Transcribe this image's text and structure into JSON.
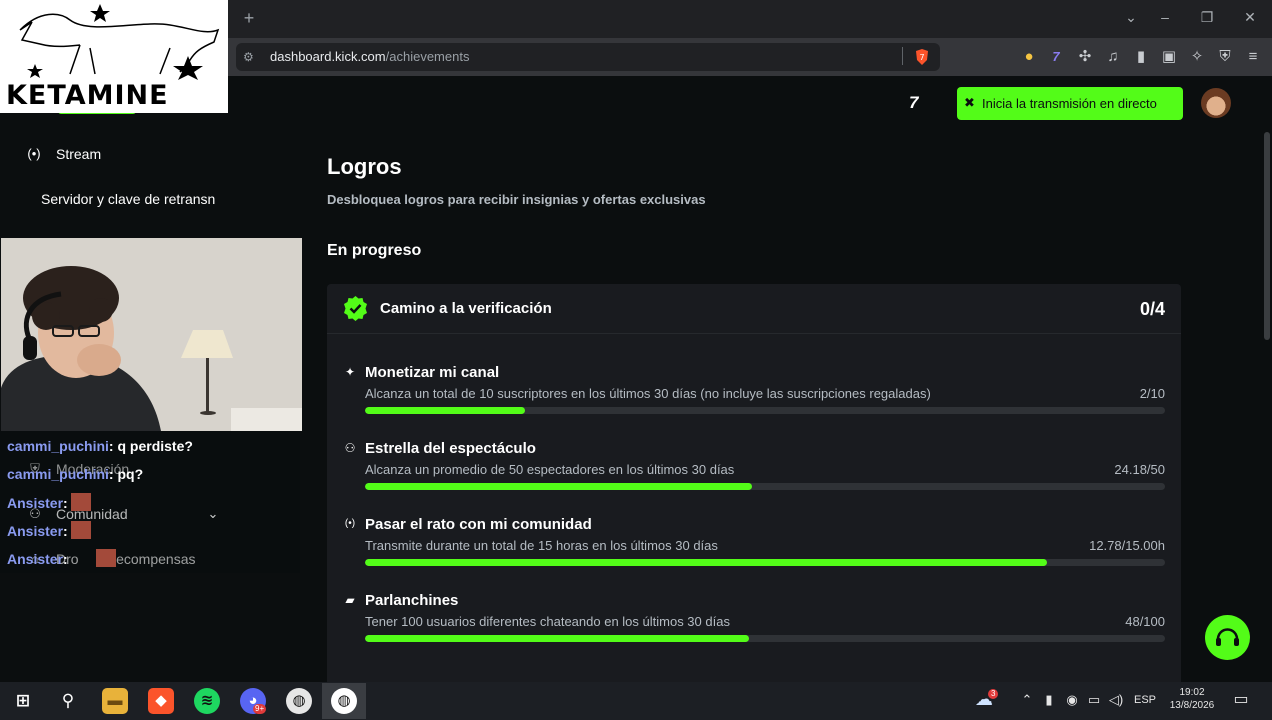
{
  "browser": {
    "url_host": "dashboard.kick.com",
    "url_path": "/achievements",
    "new_tab_label": "+",
    "shield_badge": "7",
    "window_controls": [
      "⌄",
      "–",
      "❐",
      "✕"
    ]
  },
  "header": {
    "go_live_label": "Inicia la transmisión en directo"
  },
  "sidebar": {
    "items": [
      {
        "label": "Stream",
        "icon": "broadcast-icon"
      },
      {
        "label": "Servidor y clave de retransn"
      },
      {
        "label": "Moderación",
        "icon": "shield-icon"
      },
      {
        "label": "Comunidad",
        "icon": "people-icon"
      },
      {
        "label": "Dro",
        "suffix": "y recompensas",
        "icon": "gift-icon"
      }
    ]
  },
  "main": {
    "title": "Logros",
    "subtitle": "Desbloquea logros para recibir insignias y ofertas exclusivas",
    "section_title": "En progreso",
    "card": {
      "title": "Camino a la verificación",
      "count": "0/4",
      "achievements": [
        {
          "title": "Monetizar mi canal",
          "desc": "Alcanza un total de 10 suscriptores en los últimos 30 días (no incluye las suscripciones regaladas)",
          "value_text": "2/10",
          "progress": 0.2,
          "icon": "sparkle-icon"
        },
        {
          "title": "Estrella del espectáculo",
          "desc": "Alcanza un promedio de 50 espectadores en los últimos 30 días",
          "value_text": "24.18/50",
          "progress": 0.4836,
          "icon": "viewers-icon"
        },
        {
          "title": "Pasar el rato con mi comunidad",
          "desc": "Transmite durante un total de 15 horas en los últimos 30 días",
          "value_text": "12.78/15.00h",
          "progress": 0.852,
          "icon": "broadcast-icon"
        },
        {
          "title": "Parlanchines",
          "desc": "Tener 100 usuarios diferentes chateando en los últimos 30 días",
          "value_text": "48/100",
          "progress": 0.48,
          "icon": "chat-bubble-icon"
        }
      ]
    }
  },
  "overlay": {
    "logo_text": "KETAMINE",
    "chat": [
      {
        "user": "cammi_puchini",
        "text": ": q perdiste?"
      },
      {
        "user": "cammi_puchini",
        "text": ": pq?"
      },
      {
        "user": "Ansister",
        "text": ":"
      },
      {
        "user": "Ansister",
        "text": ":"
      },
      {
        "user": "Ansister",
        "text": ":"
      }
    ]
  },
  "taskbar": {
    "weather_badge": "3",
    "language": "ESP",
    "time": "19:02",
    "date": "13/8/2026",
    "discord_badge": "9+"
  },
  "colors": {
    "accent": "#53fc18",
    "background": "#0b0e0f",
    "card": "#191b1f"
  }
}
